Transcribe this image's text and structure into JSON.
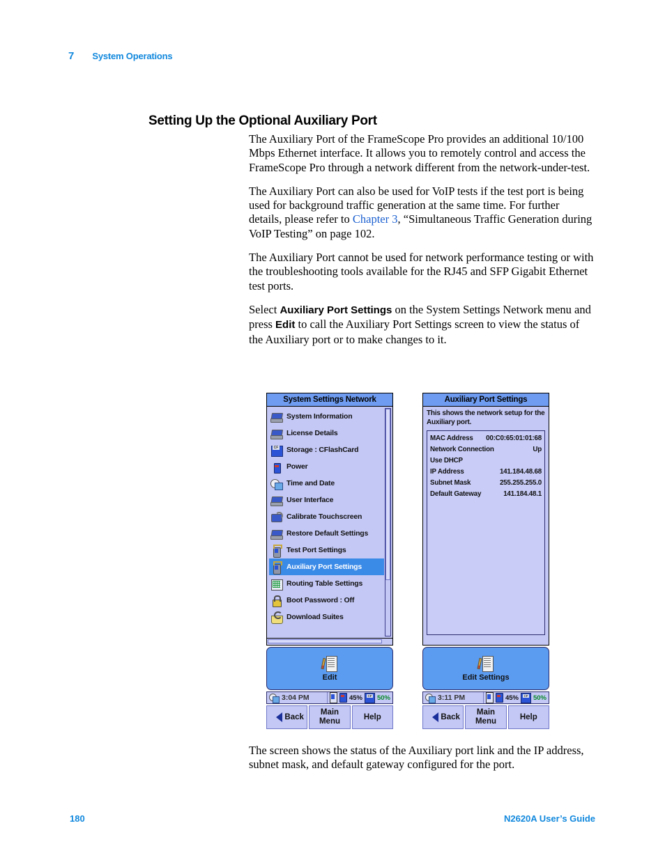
{
  "header": {
    "chapter_number": "7",
    "chapter_title": "System Operations"
  },
  "section": {
    "heading": "Setting Up the Optional Auxiliary Port"
  },
  "paragraphs": {
    "p1": "The Auxiliary Port of the FrameScope Pro provides an additional 10/100 Mbps Ethernet interface. It allows you to remotely control and access the FrameScope Pro through a network different from the network-under-test.",
    "p2_a": "The Auxiliary Port can also be used for VoIP tests if the test port is being used for background traffic generation at the same time. For further details, please refer to ",
    "p2_link": "Chapter 3",
    "p2_b": ", “Simultaneous Traffic Generation during VoIP Testing” on page 102.",
    "p3": "The Auxiliary Port cannot be used for network performance testing or with the troubleshooting tools available for the RJ45 and SFP Gigabit Ethernet test ports.",
    "p4_a": "Select ",
    "p4_b1": "Auxiliary Port Settings",
    "p4_c": " on the System Settings Network menu and press ",
    "p4_b2": "Edit",
    "p4_d": " to call the Auxiliary Port Settings screen to view the status of the Auxiliary port or to make changes to it.",
    "p5": "The screen shows the status of the Auxiliary port link and the IP address, subnet mask, and default gateway configured for the port."
  },
  "device_left": {
    "title": "System Settings Network",
    "menu_items": [
      {
        "label": "System Information",
        "icon": "notepad-icon",
        "selected": false
      },
      {
        "label": "License Details",
        "icon": "notepad-icon",
        "selected": false
      },
      {
        "label": "Storage : CFlashCard",
        "icon": "cf-floppy-icon",
        "selected": false
      },
      {
        "label": "Power",
        "icon": "battery-icon",
        "selected": false
      },
      {
        "label": "Time and Date",
        "icon": "clock-icon",
        "selected": false
      },
      {
        "label": "User Interface",
        "icon": "notepad-icon",
        "selected": false
      },
      {
        "label": "Calibrate Touchscreen",
        "icon": "touchscreen-icon",
        "selected": false
      },
      {
        "label": "Restore Default Settings",
        "icon": "notepad-icon",
        "selected": false
      },
      {
        "label": "Test Port Settings",
        "icon": "port-icon",
        "selected": false
      },
      {
        "label": "Auxiliary Port Settings",
        "icon": "port-icon",
        "selected": true
      },
      {
        "label": "Routing Table Settings",
        "icon": "grid-icon",
        "selected": false
      },
      {
        "label": "Boot Password : Off",
        "icon": "lock-icon",
        "selected": false
      },
      {
        "label": "Download Suites",
        "icon": "basket-icon",
        "selected": false
      }
    ],
    "action_button": "Edit",
    "status": {
      "time": "3:04 PM",
      "battery_pct": "45%",
      "storage_pct": "50%"
    },
    "softkeys": [
      "Back",
      "Main Menu",
      "Help"
    ]
  },
  "device_right": {
    "title": "Auxiliary Port Settings",
    "note": "This shows the network setup for the Auxiliary port.",
    "rows": [
      {
        "label": "MAC Address",
        "value": "00:C0:65:01:01:68"
      },
      {
        "label": "Network Connection",
        "value": "Up"
      },
      {
        "label": "Use DHCP",
        "value": ""
      },
      {
        "label": "IP Address",
        "value": "141.184.48.68"
      },
      {
        "label": "Subnet Mask",
        "value": "255.255.255.0"
      },
      {
        "label": "Default Gateway",
        "value": "141.184.48.1"
      }
    ],
    "action_button": "Edit Settings",
    "status": {
      "time": "3:11 PM",
      "battery_pct": "45%",
      "storage_pct": "50%"
    },
    "softkeys": [
      "Back",
      "Main Menu",
      "Help"
    ]
  },
  "footer": {
    "page_number": "180",
    "guide_title": "N2620A User’s Guide"
  },
  "colors": {
    "accent_blue": "#1188dd",
    "xref_blue": "#1a5fd0",
    "screen_titlebar": "#6f9cf0",
    "screen_bg": "#c4c8f5",
    "selection": "#3a8ae8",
    "button_blue": "#5b9bf0"
  }
}
